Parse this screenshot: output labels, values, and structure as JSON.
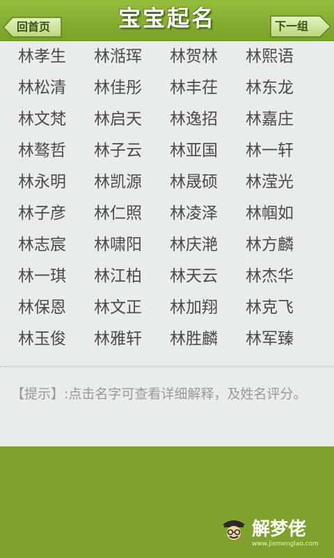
{
  "header": {
    "title": "宝宝起名",
    "back_label": "回首页",
    "next_label": "下一组"
  },
  "names": [
    "林孝生",
    "林湉珲",
    "林贺林",
    "林熙语",
    "林松清",
    "林佳彤",
    "林丰茌",
    "林东龙",
    "林文梵",
    "林启天",
    "林逸招",
    "林嘉庄",
    "林骜哲",
    "林子云",
    "林亚国",
    "林一轩",
    "林永明",
    "林凯源",
    "林晟硕",
    "林滢光",
    "林子彦",
    "林仁照",
    "林凌泽",
    "林帼如",
    "林志宸",
    "林啸阳",
    "林庆滟",
    "林方麟",
    "林一琪",
    "林江柏",
    "林天云",
    "林杰华",
    "林保恩",
    "林文正",
    "林加翔",
    "林克飞",
    "林玉俊",
    "林雅轩",
    "林胜麟",
    "林军臻"
  ],
  "tip": "【提示】:点击名字可查看详细解释，及姓名评分。",
  "watermark": {
    "text": "解梦佬",
    "url": "www.jiemenglao.com"
  },
  "colors": {
    "header_green": "#7fa22f",
    "content_bg": "#e8eceb",
    "name_text": "#4a4a4a",
    "tip_text": "#999999",
    "button_fill": "#c9e29a"
  }
}
